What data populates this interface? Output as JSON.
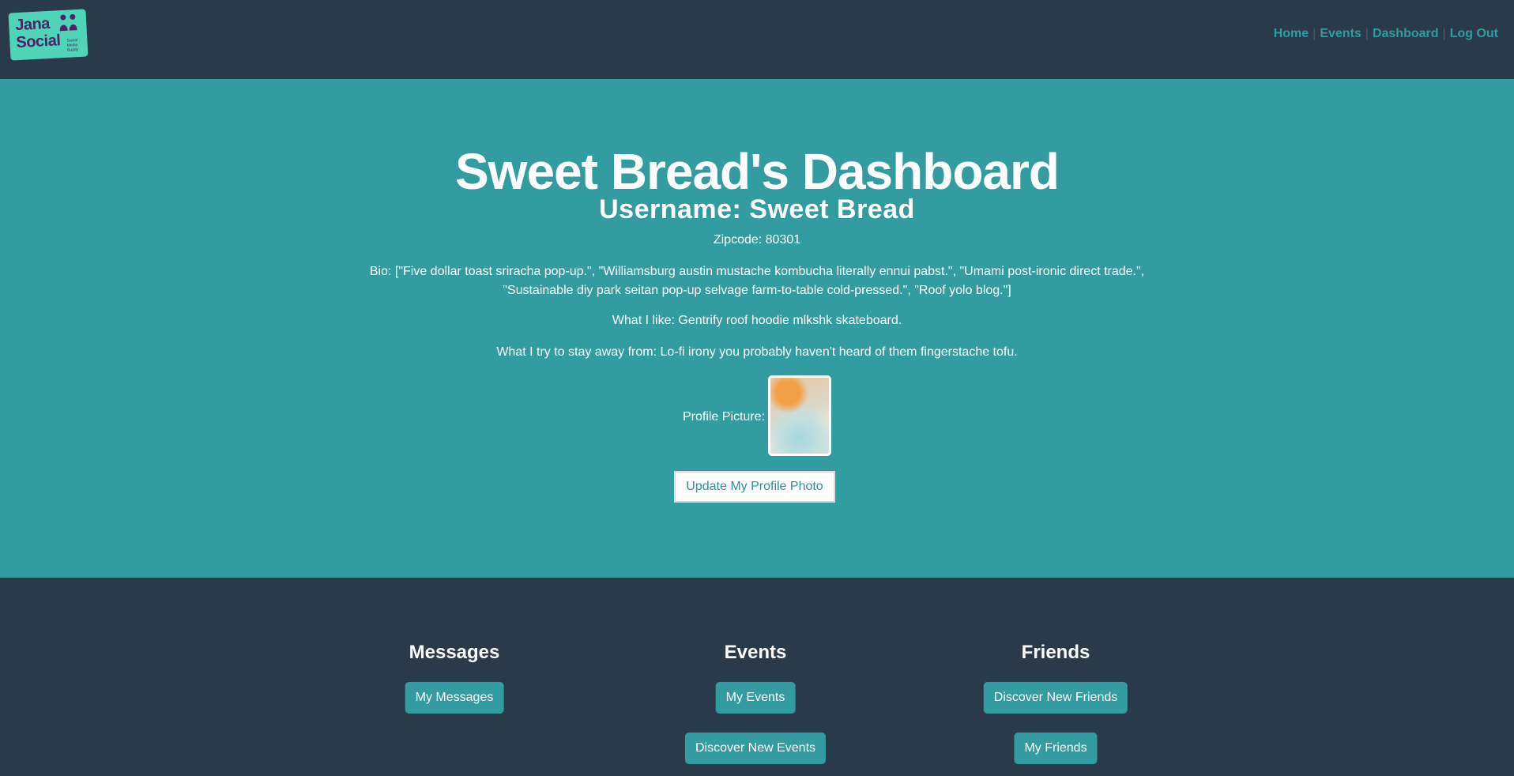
{
  "logo": {
    "line1": "Jana",
    "line2": "Social",
    "small_text": "Social Media Buddy"
  },
  "nav": {
    "items": [
      {
        "label": "Home"
      },
      {
        "label": "Events"
      },
      {
        "label": "Dashboard"
      },
      {
        "label": "Log Out"
      }
    ],
    "separator": "|"
  },
  "hero": {
    "title": "Sweet Bread's Dashboard",
    "username": "Username: Sweet Bread",
    "zipcode": "Zipcode: 80301",
    "bio": "Bio: [\"Five dollar toast sriracha pop-up.\", \"Williamsburg austin mustache kombucha literally ennui pabst.\", \"Umami post-ironic direct trade.\", \"Sustainable diy park seitan pop-up selvage farm-to-table cold-pressed.\", \"Roof yolo blog.\"]",
    "likes": "What I like: Gentrify roof hoodie mlkshk skateboard.",
    "dislikes": "What I try to stay away from: Lo-fi irony you probably haven't heard of them fingerstache tofu.",
    "profile_picture_label": "Profile Picture:",
    "update_photo_label": "Update My Profile Photo"
  },
  "sections": {
    "messages": {
      "title": "Messages",
      "button1": "My Messages"
    },
    "events": {
      "title": "Events",
      "button1": "My Events",
      "button2": "Discover New Events"
    },
    "friends": {
      "title": "Friends",
      "button1": "Discover New Friends",
      "button2": "My Friends"
    }
  },
  "colors": {
    "navbar_bg": "#2a3a4a",
    "hero_bg": "#339ca1",
    "accent": "#2e9ea0",
    "logo_bg": "#4fd4b8",
    "logo_text": "#4a2466"
  }
}
